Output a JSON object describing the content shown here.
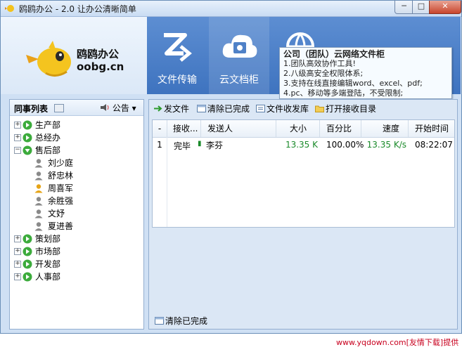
{
  "window": {
    "title": "鸥鸥办公 - 2.0 让办公清晰简单",
    "min_glyph": "─",
    "max_glyph": "□",
    "close_glyph": "✕"
  },
  "brand": {
    "name": "鸥鸥办公",
    "url": "oobg.cn"
  },
  "nav": {
    "tabs": [
      {
        "label": "文件传输"
      },
      {
        "label": "云文档柜"
      }
    ]
  },
  "tooltip": {
    "title": "公司（团队）云网络文件柜",
    "lines": [
      "1.团队高效协作工具!",
      "2.八级高安全权限体系;",
      "3.支持在线直接编辑word、excel、pdf;",
      "4.pc、移动等多端登陆，不受限制;"
    ]
  },
  "contacts": {
    "title": "同事列表",
    "notice": "公告",
    "groups": [
      {
        "name": "生产部",
        "expanded": false
      },
      {
        "name": "总经办",
        "expanded": false
      },
      {
        "name": "售后部",
        "expanded": true
      },
      {
        "name": "策划部",
        "expanded": false
      },
      {
        "name": "市场部",
        "expanded": false
      },
      {
        "name": "开发部",
        "expanded": false
      },
      {
        "name": "人事部",
        "expanded": false
      }
    ],
    "members": [
      {
        "name": "刘少庭",
        "online": false
      },
      {
        "name": "舒忠林",
        "online": false
      },
      {
        "name": "周喜军",
        "online": true
      },
      {
        "name": "余胜强",
        "online": false
      },
      {
        "name": "文妤",
        "online": false
      },
      {
        "name": "夏进善",
        "online": false
      }
    ]
  },
  "toolbar": {
    "send": "发文件",
    "clear_done": "清除已完成",
    "inbox": "文件收发库",
    "open_dir": "打开接收目录"
  },
  "table": {
    "headers": [
      "-",
      "接收...",
      "发送人",
      "大小",
      "百分比",
      "速度",
      "开始时间"
    ],
    "rows": [
      {
        "index": "1",
        "status": "完毕",
        "sender": "李芬",
        "size": "13.35 K",
        "percent": "100.00%",
        "speed": "13.35 K/s",
        "start": "08:22:07"
      }
    ]
  },
  "bottom": {
    "clear_done": "清除已完成"
  },
  "footer": "www.yqdown.com[友情下载]提供",
  "colors": {
    "accent": "#3e73bf",
    "green_text": "#1a8a2a",
    "footer_red": "#c8001e"
  }
}
